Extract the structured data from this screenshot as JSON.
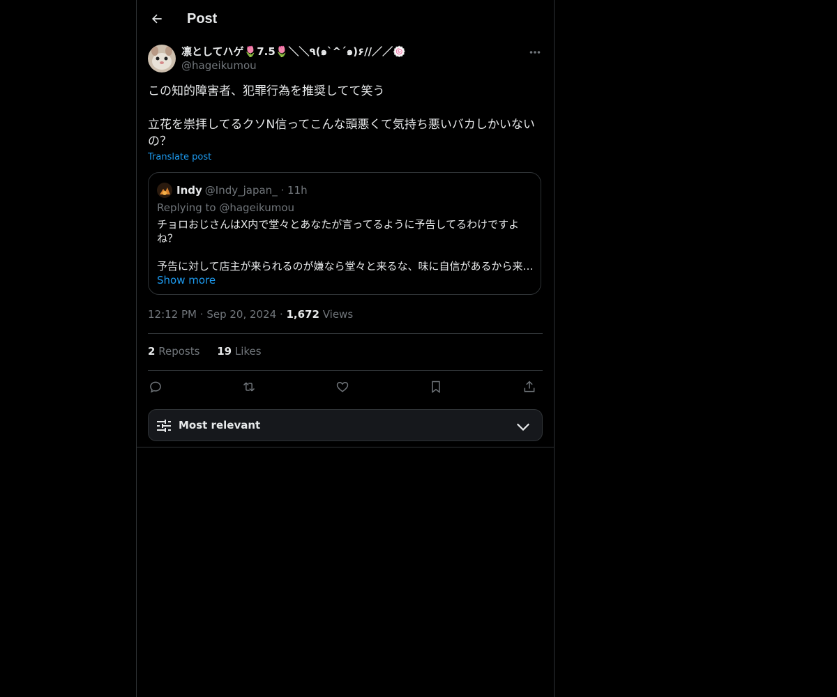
{
  "header": {
    "title": "Post"
  },
  "post": {
    "display_name": "凛としてハゲ🌷7.5🌷＼＼٩(๑`^´๑)۶//／／🍥",
    "handle": "@hageikumou",
    "text": "この知的障害者、犯罪行為を推奨してて笑う\n\n立花を崇拝してるクソN信ってこんな頭悪くて気持ち悪いバカしかいないの？",
    "translate_label": "Translate post",
    "time": "12:12 PM",
    "date": "Sep 20, 2024",
    "views_count": "1,672",
    "views_label": "Views",
    "reposts_count": "2",
    "reposts_label": "Reposts",
    "likes_count": "19",
    "likes_label": "Likes"
  },
  "quote": {
    "name": "Indy",
    "handle": "@Indy_japan_",
    "time": "11h",
    "replying_to_prefix": "Replying to",
    "replying_to_handle": "@hageikumou",
    "text": "チョロおじさんはX内で堂々とあなたが言ってるように予告してるわけですよね？",
    "text2": "予告に対して店主が来られるのが嫌なら堂々と来るな、味に自信があるから来…",
    "show_more": "Show more"
  },
  "sort": {
    "label": "Most relevant"
  },
  "icons": {
    "back": "arrow-left-icon",
    "more": "more-dots-icon",
    "reply": "reply-icon",
    "repost": "repost-icon",
    "like": "heart-icon",
    "bookmark": "bookmark-icon",
    "share": "share-icon",
    "sort": "sliders-icon",
    "chevron": "chevron-down-icon"
  },
  "colors": {
    "background": "#000000",
    "accent": "#1d9bf0",
    "muted": "#71767b",
    "border": "#2f3336",
    "text": "#e7e9ea"
  }
}
